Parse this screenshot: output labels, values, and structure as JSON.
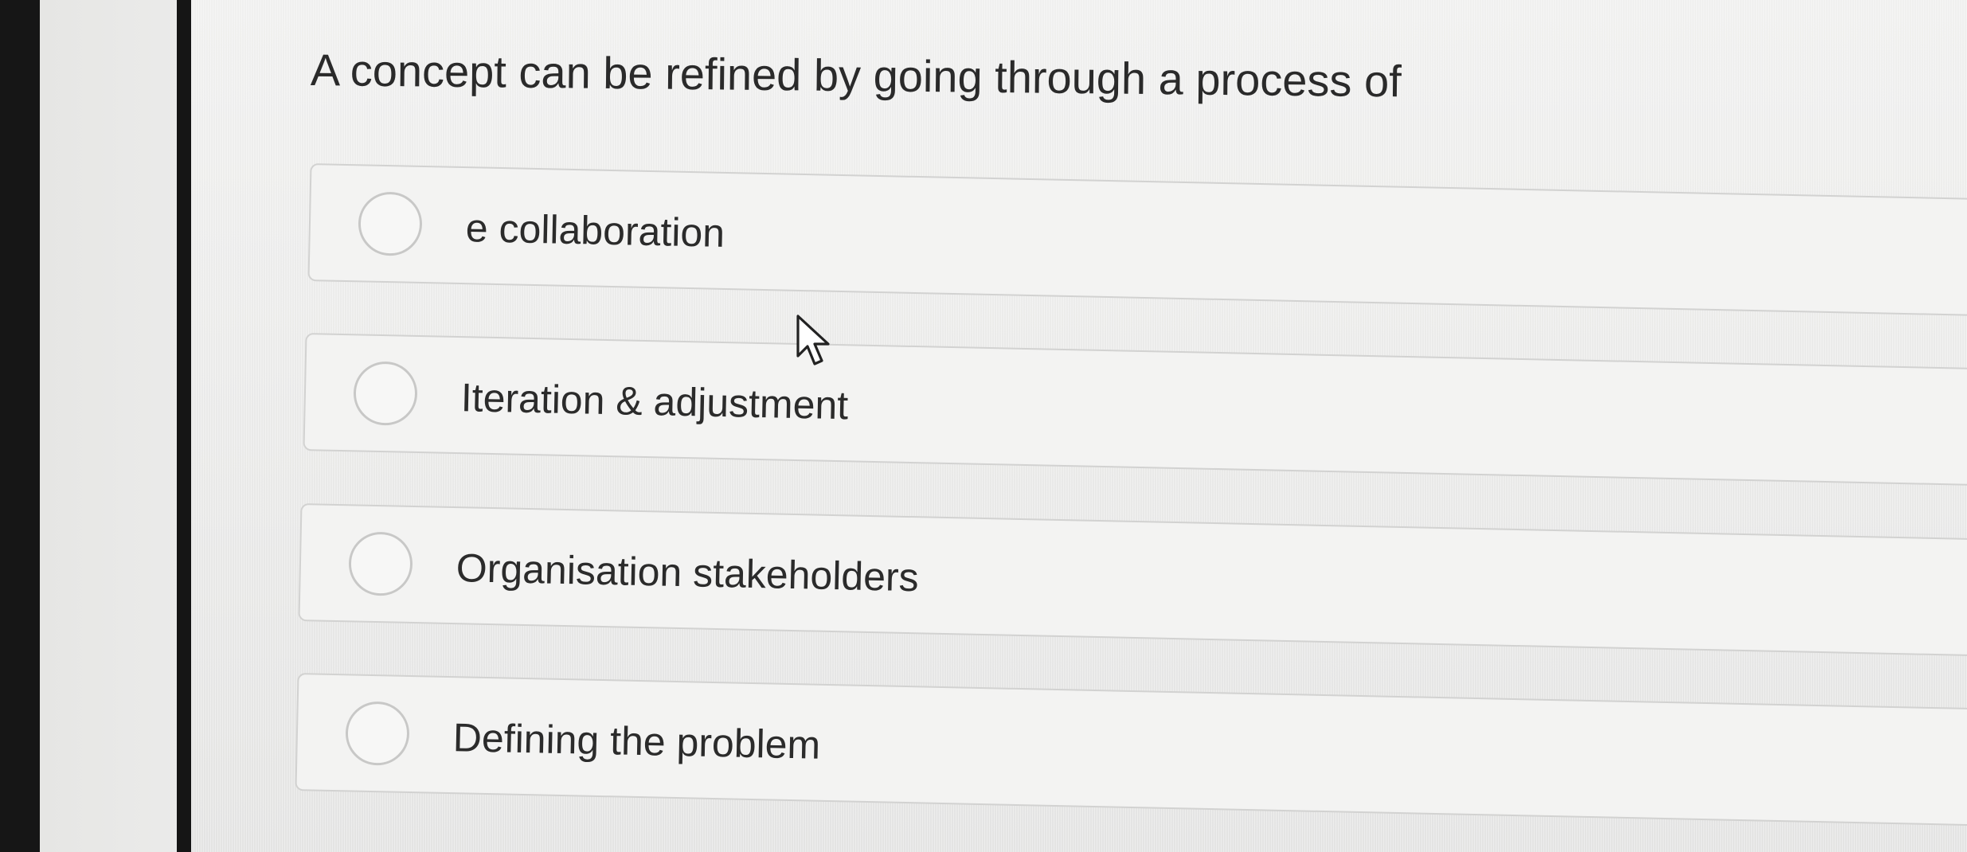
{
  "quiz": {
    "question": "A concept can be refined by going through a process of",
    "options": [
      {
        "label": "e collaboration"
      },
      {
        "label": "Iteration & adjustment"
      },
      {
        "label": "Organisation stakeholders"
      },
      {
        "label": "Defining the problem"
      }
    ]
  },
  "icons": {
    "radio": "radio-button-unselected",
    "cursor": "mouse-pointer"
  },
  "colors": {
    "text": "#2a2a2a",
    "option_bg": "#f3f3f2",
    "option_border": "#d2d2d1",
    "radio_border": "#c8c8c7"
  }
}
